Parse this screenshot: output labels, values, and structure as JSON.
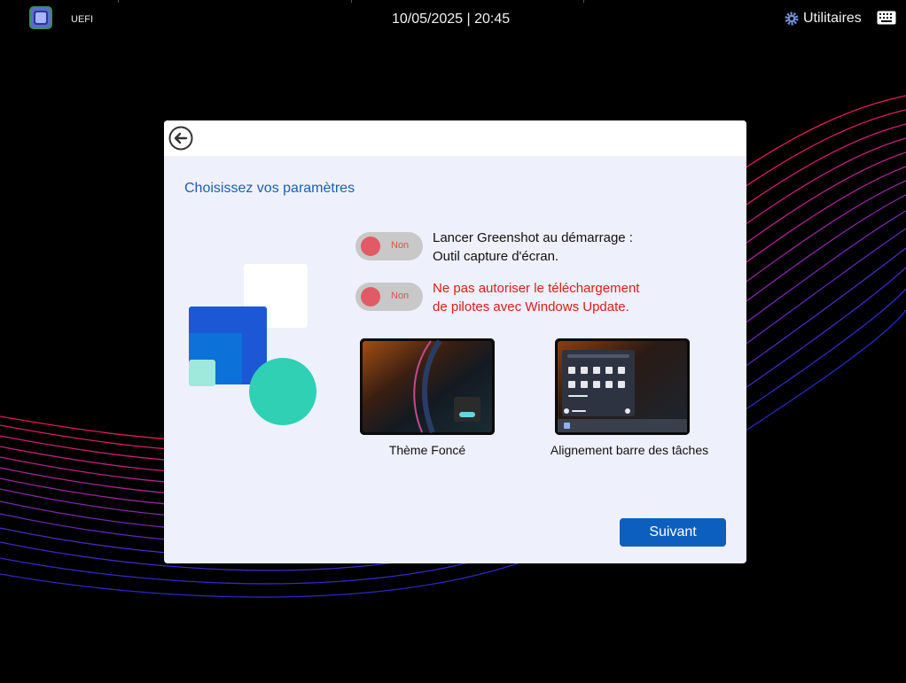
{
  "topbar": {
    "app_name": "UEFI",
    "datetime": "10/05/2025 | 20:45",
    "utilities_label": "Utilitaires",
    "icons": {
      "logo": "app-logo-icon",
      "utilities": "gear-icon",
      "keyboard": "keyboard-icon"
    }
  },
  "dialog": {
    "back_icon": "back-arrow-icon",
    "title": "Choisissez vos paramètres",
    "options": [
      {
        "toggle_state": "Non",
        "text_line1": "Lancer Greenshot au démarrage :",
        "text_line2": "Outil capture d'écran."
      },
      {
        "toggle_state": "Non",
        "text_line1": "Ne pas autoriser le téléchargement",
        "text_line2": "de pilotes avec Windows Update."
      }
    ],
    "thumbnails": [
      {
        "caption": "Thème Foncé"
      },
      {
        "caption": "Alignement barre des tâches"
      }
    ],
    "next_label": "Suivant"
  },
  "colors": {
    "accent": "#0c5fbf",
    "title": "#1a5fb4",
    "warning_text": "#e01b1b",
    "toggle_knob": "#e05b65",
    "dialog_bg": "#eef1fb"
  }
}
